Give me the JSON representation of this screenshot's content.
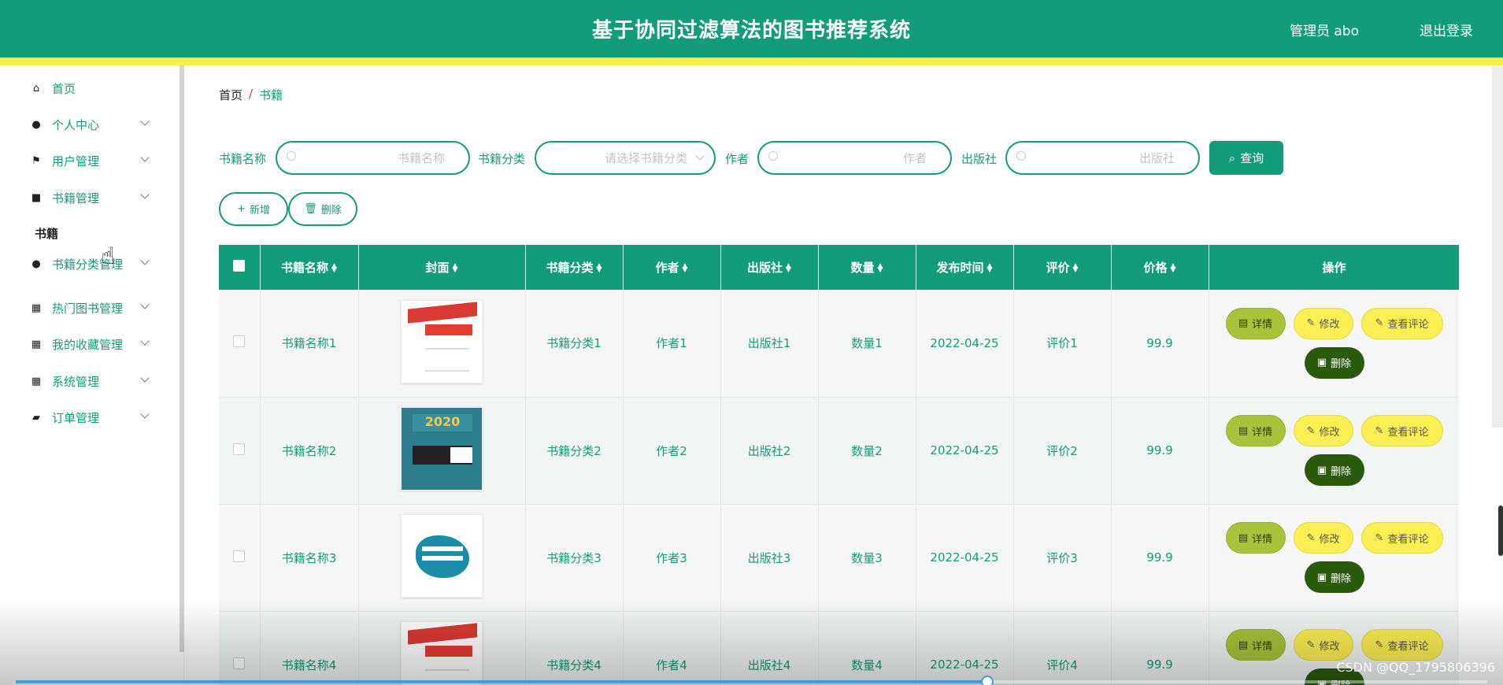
{
  "header": {
    "title": "基于协同过滤算法的图书推荐系统",
    "user": "管理员 abo",
    "logout": "退出登录"
  },
  "sidebar": {
    "items": [
      {
        "label": "首页",
        "icon": "home-icon"
      },
      {
        "label": "个人中心",
        "icon": "user-icon"
      },
      {
        "label": "用户管理",
        "icon": "flag-icon"
      },
      {
        "label": "书籍管理",
        "icon": "briefcase-icon"
      },
      {
        "label": "书籍分类管理",
        "icon": "user-icon"
      },
      {
        "label": "热门图书管理",
        "icon": "grid-icon"
      },
      {
        "label": "我的收藏管理",
        "icon": "grid-icon"
      },
      {
        "label": "系统管理",
        "icon": "grid-icon"
      },
      {
        "label": "订单管理",
        "icon": "ticket-icon"
      }
    ],
    "submenu_label": "书籍"
  },
  "breadcrumb": {
    "home": "首页",
    "separator": "/",
    "current": "书籍"
  },
  "search": {
    "name_label": "书籍名称",
    "name_placeholder": "书籍名称",
    "category_label": "书籍分类",
    "category_placeholder": "请选择书籍分类",
    "author_label": "作者",
    "author_placeholder": "作者",
    "publisher_label": "出版社",
    "publisher_placeholder": "出版社",
    "query_button": "查询"
  },
  "actions": {
    "add": "新增",
    "delete": "删除"
  },
  "table": {
    "headers": [
      "书籍名称",
      "封面",
      "书籍分类",
      "作者",
      "出版社",
      "数量",
      "发布时间",
      "评价",
      "价格",
      "操作"
    ],
    "rows": [
      {
        "name": "书籍名称1",
        "category": "书籍分类1",
        "author": "作者1",
        "publisher": "出版社1",
        "quantity": "数量1",
        "date": "2022-04-25",
        "rating": "评价1",
        "price": "99.9"
      },
      {
        "name": "书籍名称2",
        "category": "书籍分类2",
        "author": "作者2",
        "publisher": "出版社2",
        "quantity": "数量2",
        "date": "2022-04-25",
        "rating": "评价2",
        "price": "99.9"
      },
      {
        "name": "书籍名称3",
        "category": "书籍分类3",
        "author": "作者3",
        "publisher": "出版社3",
        "quantity": "数量3",
        "date": "2022-04-25",
        "rating": "评价3",
        "price": "99.9"
      },
      {
        "name": "书籍名称4",
        "category": "书籍分类4",
        "author": "作者4",
        "publisher": "出版社4",
        "quantity": "数量4",
        "date": "2022-04-25",
        "rating": "评价4",
        "price": "99.9"
      }
    ],
    "op_labels": {
      "detail": "详情",
      "edit": "修改",
      "comments": "查看评论",
      "delete": "删除"
    },
    "cover_texts": {
      "cover2_year": "2020"
    }
  },
  "video": {
    "watermark": "CSDN @QQ_1795806396",
    "progress": 0.66
  },
  "colors": {
    "primary": "#139c7a",
    "accent_bar": "#f6ef48",
    "detail_btn": "#a9c43a",
    "edit_btn": "#fbef53",
    "delete_btn": "#2c5a0c"
  }
}
